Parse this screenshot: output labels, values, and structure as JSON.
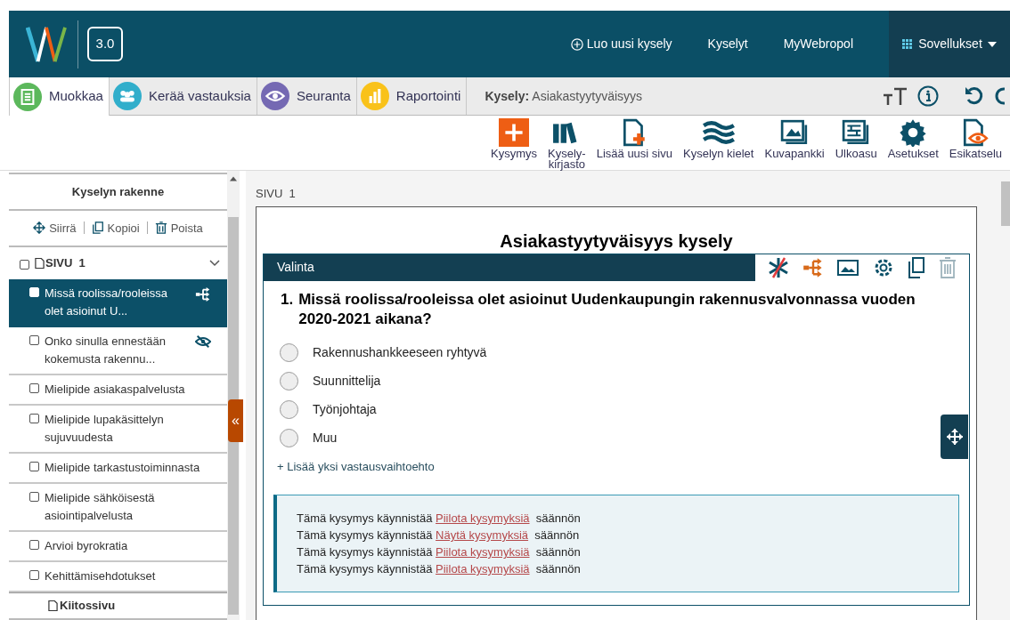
{
  "header": {
    "version": "3.0",
    "nav": [
      {
        "label": "Luo uusi kysely",
        "kind": "create"
      },
      {
        "label": "Kyselyt",
        "kind": "link"
      },
      {
        "label": "MyWebropol",
        "kind": "link"
      },
      {
        "label": "Sovellukset",
        "kind": "apps"
      }
    ]
  },
  "tabs": [
    {
      "label": "Muokkaa",
      "selected": true,
      "color": "#5cb85c"
    },
    {
      "label": "Kerää vastauksia",
      "selected": false,
      "color": "#31aecb"
    },
    {
      "label": "Seuranta",
      "selected": false,
      "color": "#7569b3"
    },
    {
      "label": "Raportointi",
      "selected": false,
      "color": "#f9c21a"
    }
  ],
  "survey": {
    "label": "Kysely:",
    "name": "Asiakastyytyväisyys"
  },
  "toolbar": [
    {
      "label": "Kysymys"
    },
    {
      "label": "Kysely-\nkirjasto"
    },
    {
      "label": "Lisää uusi sivu"
    },
    {
      "label": "Kyselyn kielet"
    },
    {
      "label": "Kuvapankki"
    },
    {
      "label": "Ulkoasu"
    },
    {
      "label": "Asetukset"
    },
    {
      "label": "Esikatselu"
    }
  ],
  "sidebar": {
    "title": "Kyselyn rakenne",
    "actions": [
      "Siirrä",
      "Kopioi",
      "Poista"
    ],
    "page": {
      "label": "SIVU  1",
      "checked": false,
      "expanded": true
    },
    "items": [
      {
        "label": "Missä roolissa/rooleissa olet asioinut U...",
        "selected": true,
        "checked": false,
        "kind": "logic"
      },
      {
        "label": "Onko sinulla ennestään kokemusta rakennu...",
        "selected": false,
        "checked": false,
        "kind": "hidden"
      },
      {
        "label": "Mielipide asiakaspalvelusta",
        "selected": false,
        "checked": false,
        "kind": "plain"
      },
      {
        "label": "Mielipide lupakäsittelyn sujuvuudesta",
        "selected": false,
        "checked": false,
        "kind": "plain"
      },
      {
        "label": "Mielipide tarkastustoiminnasta",
        "selected": false,
        "checked": false,
        "kind": "plain"
      },
      {
        "label": "Mielipide sähköisestä asiointipalvelusta",
        "selected": false,
        "checked": false,
        "kind": "plain"
      },
      {
        "label": "Arvioi byrokratia",
        "selected": false,
        "checked": false,
        "kind": "plain"
      },
      {
        "label": "Kehittämisehdotukset",
        "selected": false,
        "checked": false,
        "kind": "plain"
      }
    ],
    "end_page": "Kiitossivu",
    "collapse": "«"
  },
  "page_label": "SIVU  1",
  "survey_title": "Asiakastyytyväisyys kysely",
  "question": {
    "type": "Valinta",
    "number": "1.",
    "text": "Missä roolissa/rooleissa olet asioinut Uudenkaupungin rakennusvalvonnassa vuoden 2020-2021 aikana?",
    "options": [
      {
        "label": "Rakennushankkeeseen ryhtyvä",
        "selected": false
      },
      {
        "label": "Suunnittelija",
        "selected": false
      },
      {
        "label": "Työnjohtaja",
        "selected": false
      },
      {
        "label": "Muu",
        "selected": false
      }
    ],
    "add_option": "+ Lisää yksi vastausvaihtoehto",
    "rules": [
      {
        "prefix": "Tämä kysymys käynnistää",
        "link": "Piilota kysymyksiä",
        "suffix": "säännön"
      },
      {
        "prefix": "Tämä kysymys käynnistää",
        "link": "Näytä kysymyksiä",
        "suffix": "säännön"
      },
      {
        "prefix": "Tämä kysymys käynnistää",
        "link": "Piilota kysymyksiä",
        "suffix": "säännön"
      },
      {
        "prefix": "Tämä kysymys käynnistää",
        "link": "Piilota kysymyksiä",
        "suffix": "säännön"
      }
    ]
  }
}
